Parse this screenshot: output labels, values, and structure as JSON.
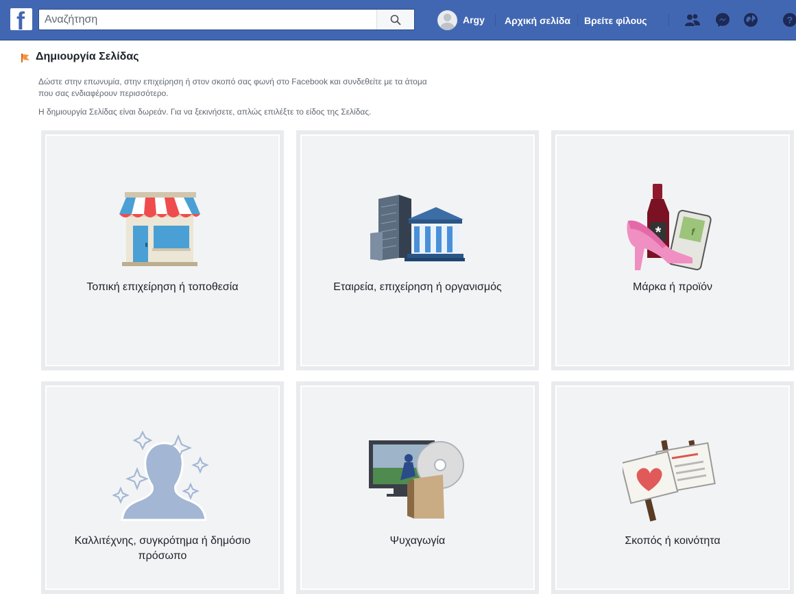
{
  "topbar": {
    "logo_letter": "f",
    "search": {
      "placeholder": "Αναζήτηση",
      "value": ""
    },
    "user_name": "Argy",
    "links": [
      "Αρχική σελίδα",
      "Βρείτε φίλους"
    ],
    "icons": [
      "friend-requests-icon",
      "messenger-icon",
      "notifications-globe-icon",
      "help-icon"
    ],
    "brand_color": "#4267b2"
  },
  "page": {
    "title": "Δημιουργία Σελίδας",
    "description_line1": "Δώστε στην επωνυμία, στην επιχείρηση ή στον σκοπό σας φωνή στο Facebook και συνδεθείτε με τα άτομα",
    "description_line2": "που σας ενδιαφέρουν περισσότερο.",
    "description_line3": "Η δημιουργία Σελίδας είναι δωρεάν. Για να ξεκινήσετε, απλώς επιλέξτε το είδος της Σελίδας."
  },
  "categories": [
    {
      "label": "Τοπική επιχείρηση ή τοποθεσία",
      "icon": "storefront-icon"
    },
    {
      "label": "Εταιρεία, επιχείρηση ή οργανισμός",
      "icon": "company-building-icon"
    },
    {
      "label": "Μάρκα ή προϊόν",
      "icon": "brand-product-icon"
    },
    {
      "label_line1": "Καλλιτέχνης, συγκρότημα ή δημόσιο",
      "label_line2": "πρόσωπο",
      "icon": "public-figure-icon"
    },
    {
      "label": "Ψυχαγωγία",
      "icon": "entertainment-icon"
    },
    {
      "label": "Σκοπός ή κοινότητα",
      "icon": "cause-community-icon"
    }
  ]
}
